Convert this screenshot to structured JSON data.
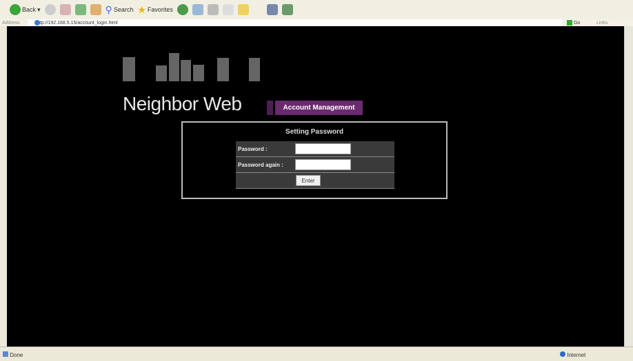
{
  "browser": {
    "toolbar": {
      "back_label": "Back",
      "search_label": "Search",
      "favorites_label": "Favorites"
    },
    "address_label": "Address",
    "url": "http://192.168.5.15/account_login.html",
    "go_label": "Go",
    "links_label": "Links",
    "status_text": "Done",
    "zone_text": "Internet"
  },
  "page": {
    "logo_text": "Neighbor Web",
    "tab_label": "Account Management",
    "form": {
      "title": "Setting Password",
      "password_label": "Password :",
      "password_again_label": "Password again :",
      "password_value": "",
      "password_again_value": "",
      "enter_label": "Enter"
    }
  }
}
